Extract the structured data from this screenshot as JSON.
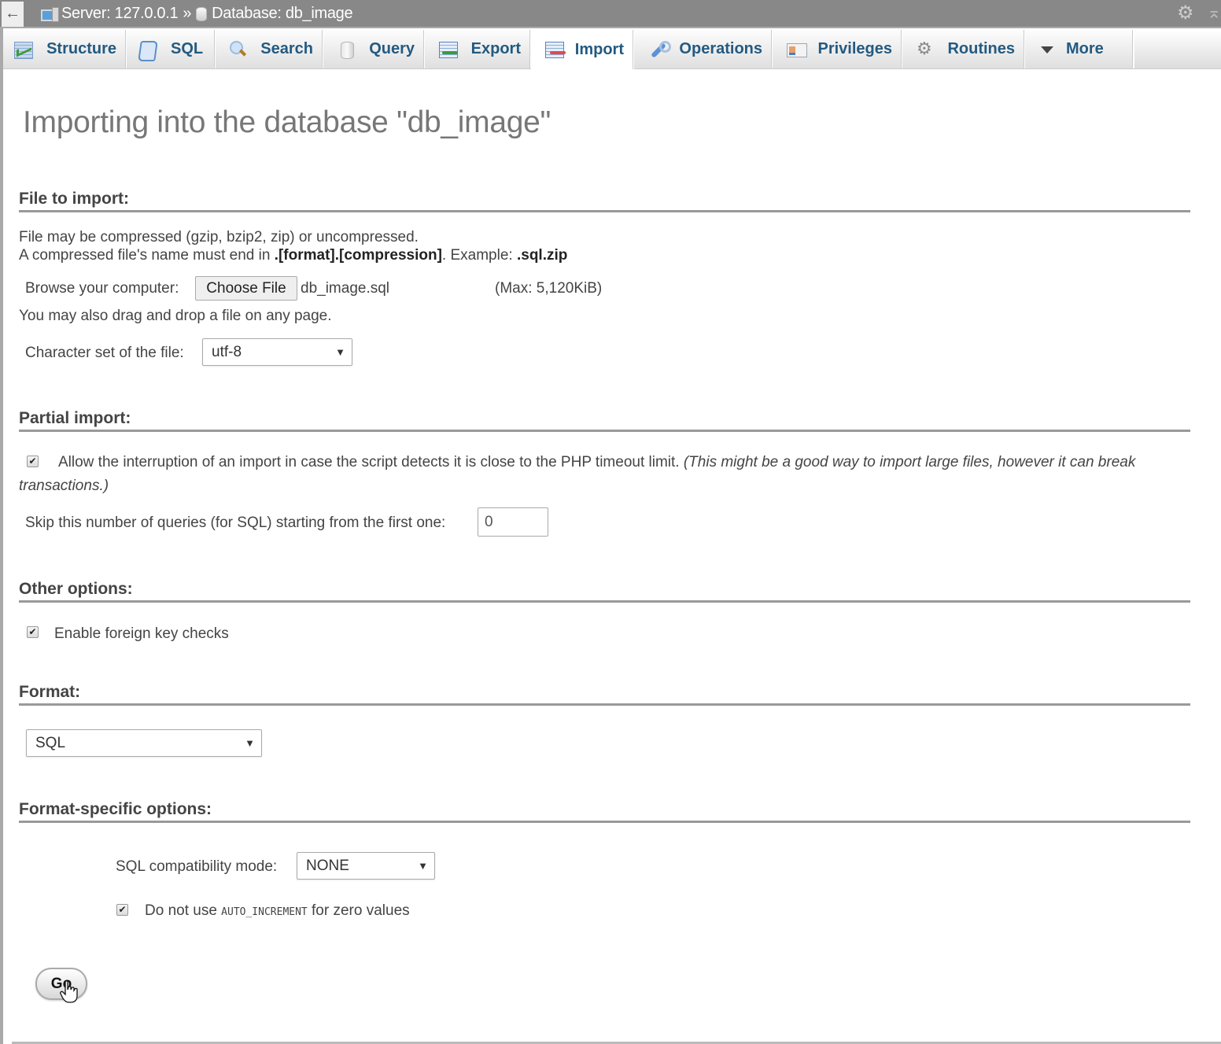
{
  "topbar": {
    "back_label": "←",
    "server_label": "Server: 127.0.0.1",
    "separator": "»",
    "database_label": "Database: db_image",
    "settings_icon": "gear-icon",
    "collapse_icon": "collapse-icon"
  },
  "tabs": [
    {
      "label": "Structure",
      "icon": "structure-icon",
      "active": false
    },
    {
      "label": "SQL",
      "icon": "sql-icon",
      "active": false
    },
    {
      "label": "Search",
      "icon": "search-icon",
      "active": false
    },
    {
      "label": "Query",
      "icon": "query-icon",
      "active": false
    },
    {
      "label": "Export",
      "icon": "export-icon",
      "active": false
    },
    {
      "label": "Import",
      "icon": "import-icon",
      "active": true
    },
    {
      "label": "Operations",
      "icon": "operations-icon",
      "active": false
    },
    {
      "label": "Privileges",
      "icon": "privileges-icon",
      "active": false
    },
    {
      "label": "Routines",
      "icon": "routines-icon",
      "active": false
    },
    {
      "label": "More",
      "icon": "caret-down-icon",
      "active": false
    }
  ],
  "page": {
    "title": "Importing into the database \"db_image\""
  },
  "file_section": {
    "heading": "File to import:",
    "line1": "File may be compressed (gzip, bzip2, zip) or uncompressed.",
    "line2_prefix": "A compressed file's name must end in ",
    "line2_bold1": ".[format].[compression]",
    "line2_mid": ". Example: ",
    "line2_bold2": ".sql.zip",
    "browse_label": "Browse your computer:",
    "choose_button": "Choose File",
    "chosen_file": "db_image.sql",
    "max_size": "(Max: 5,120KiB)",
    "drag_hint": "You may also drag and drop a file on any page.",
    "charset_label": "Character set of the file:",
    "charset_value": "utf-8"
  },
  "partial_section": {
    "heading": "Partial import:",
    "allow_interrupt_checked": true,
    "allow_interrupt_text": "Allow the interruption of an import in case the script detects it is close to the PHP timeout limit.",
    "allow_interrupt_note_1": "(This might be a good way to import large files, however it can break",
    "allow_interrupt_note_2": "transactions.)",
    "skip_label": "Skip this number of queries (for SQL) starting from the first one:",
    "skip_value": "0"
  },
  "other_section": {
    "heading": "Other options:",
    "fk_checked": true,
    "fk_label": "Enable foreign key checks"
  },
  "format_section": {
    "heading": "Format:",
    "format_value": "SQL"
  },
  "format_specific": {
    "heading": "Format-specific options:",
    "compat_label": "SQL compatibility mode:",
    "compat_value": "NONE",
    "auto_inc_checked": true,
    "auto_inc_prefix": "Do not use ",
    "auto_inc_code": "AUTO_INCREMENT",
    "auto_inc_suffix": " for zero values"
  },
  "actions": {
    "go_label": "Go"
  },
  "glyphs": {
    "check": "✔",
    "dropdown_arrow": "▼",
    "gear": "⚙",
    "collapse": "⌅"
  }
}
